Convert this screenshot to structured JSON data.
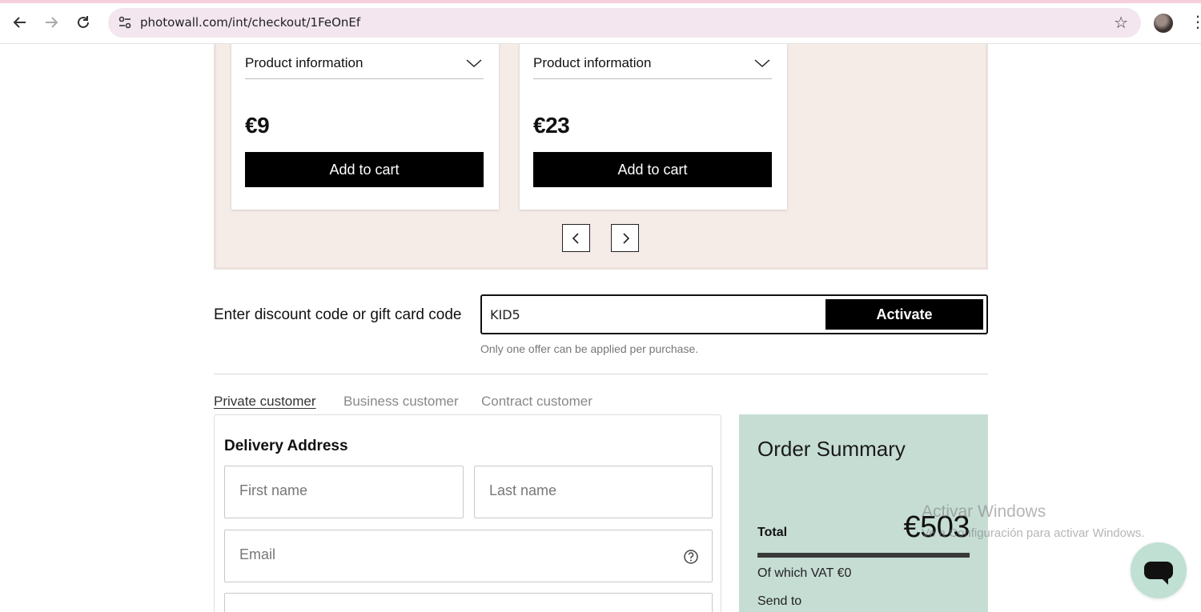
{
  "browser": {
    "url": "photowall.com/int/checkout/1FeOnEf",
    "icons": [
      "back-icon",
      "forward-icon",
      "reload-icon",
      "site-info-icon",
      "star-icon",
      "avatar",
      "kebab-menu-icon"
    ]
  },
  "recommendations": {
    "cards": [
      {
        "info_label": "Product information",
        "price": "€9",
        "button": "Add to cart"
      },
      {
        "info_label": "Product information",
        "price": "€23",
        "button": "Add to cart"
      }
    ]
  },
  "discount": {
    "label": "Enter discount code or gift card code",
    "value": "KID5",
    "button": "Activate",
    "note": "Only one offer can be applied per purchase."
  },
  "customer_tabs": [
    "Private customer",
    "Business customer",
    "Contract customer"
  ],
  "address": {
    "title": "Delivery Address",
    "first_name_placeholder": "First name",
    "last_name_placeholder": "Last name",
    "email_placeholder": "Email"
  },
  "summary": {
    "title": "Order Summary",
    "total_label": "Total",
    "total_value": "€503",
    "vat": "Of which VAT €0",
    "send_to": "Send to"
  },
  "watermark": {
    "line1": "Activar Windows",
    "line2": "Ve a Configuración para activar Windows."
  },
  "colors": {
    "panel_bg": "#f5ece8",
    "summary_bg": "#c6ddd4",
    "button_bg": "#000000",
    "chat_bg": "#bfe0d3"
  }
}
